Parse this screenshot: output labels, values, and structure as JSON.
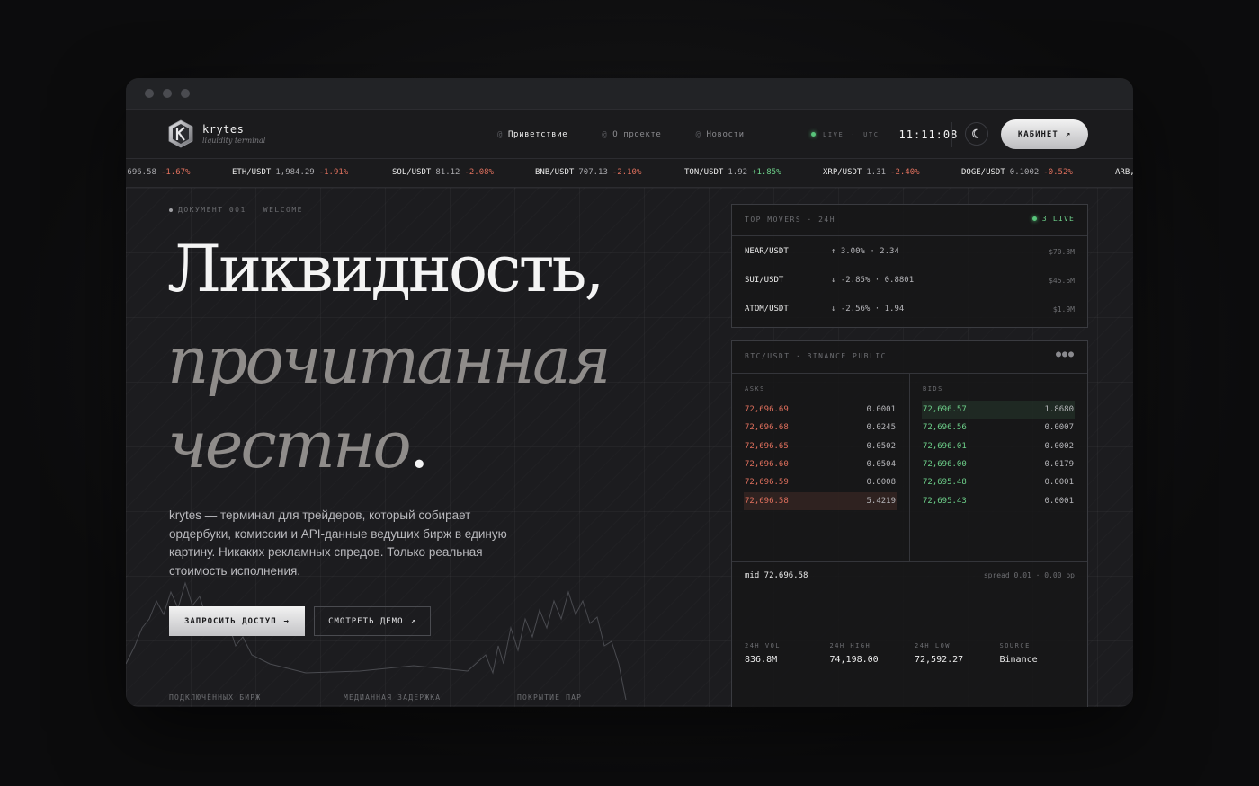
{
  "brand": {
    "name": "krytes",
    "tagline": "liquidity terminal"
  },
  "nav": {
    "tabs": [
      {
        "label": "Приветствие",
        "active": true
      },
      {
        "label": "О проекте",
        "active": false
      },
      {
        "label": "Новости",
        "active": false
      }
    ],
    "live_label": "LIVE",
    "tz_label": "UTC",
    "time": "11:11:08",
    "cabinet_label": "КАБИНЕТ",
    "cabinet_icon": "arrow-up-right-icon",
    "theme_icon": "moon-icon"
  },
  "ticker": [
    {
      "symbol": "",
      "price": ",696.58",
      "change": "-1.67%",
      "dir": "neg"
    },
    {
      "symbol": "ETH/USDT",
      "price": "1,984.29",
      "change": "-1.91%",
      "dir": "neg"
    },
    {
      "symbol": "SOL/USDT",
      "price": "81.12",
      "change": "-2.08%",
      "dir": "neg"
    },
    {
      "symbol": "BNB/USDT",
      "price": "707.13",
      "change": "-2.10%",
      "dir": "neg"
    },
    {
      "symbol": "TON/USDT",
      "price": "1.92",
      "change": "+1.85%",
      "dir": "pos"
    },
    {
      "symbol": "XRP/USDT",
      "price": "1.31",
      "change": "-2.40%",
      "dir": "neg"
    },
    {
      "symbol": "DOGE/USDT",
      "price": "0.1002",
      "change": "-0.52%",
      "dir": "neg"
    },
    {
      "symbol": "ARB,",
      "price": "",
      "change": "",
      "dir": "neg"
    }
  ],
  "hero": {
    "doc_label": "ДОКУМЕНТ 001 · WELCOME",
    "line1": "Ликвидность,",
    "line2": "прочитанная",
    "line3": "честно",
    "line3_end": ".",
    "description": "krytes — терминал для трейдеров, который собирает ордербуки, комиссии и API-данные ведущих бирж в единую картину. Никаких рекламных спредов. Только реальная стоимость исполнения.",
    "primary_cta": "ЗАПРОСИТЬ ДОСТУП",
    "primary_icon": "arrow-right-icon",
    "secondary_cta": "СМОТРЕТЬ ДЕМО",
    "secondary_icon": "arrow-up-right-icon",
    "stats": [
      "ПОДКЛЮЧЁННЫХ БИРЖ",
      "МЕДИАННАЯ ЗАДЕРЖКА",
      "ПОКРЫТИЕ ПАР"
    ]
  },
  "movers": {
    "title": "TOP MOVERS · 24H",
    "live": "3 LIVE",
    "rows": [
      {
        "symbol": "NEAR/USDT",
        "change": "↑ 3.00% · 2.34",
        "volume": "$70.3M"
      },
      {
        "symbol": "SUI/USDT",
        "change": "↓ -2.85% · 0.8801",
        "volume": "$45.6M"
      },
      {
        "symbol": "ATOM/USDT",
        "change": "↓ -2.56% · 1.94",
        "volume": "$1.9M"
      }
    ]
  },
  "book": {
    "title": "BTC/USDT · BINANCE PUBLIC",
    "more_icon": "more-dots-icon",
    "asks_label": "ASKS",
    "bids_label": "BIDS",
    "asks": [
      {
        "price": "72,696.69",
        "qty": "0.0001"
      },
      {
        "price": "72,696.68",
        "qty": "0.0245"
      },
      {
        "price": "72,696.65",
        "qty": "0.0502"
      },
      {
        "price": "72,696.60",
        "qty": "0.0504"
      },
      {
        "price": "72,696.59",
        "qty": "0.0008"
      },
      {
        "price": "72,696.58",
        "qty": "5.4219"
      }
    ],
    "bids": [
      {
        "price": "72,696.57",
        "qty": "1.8680"
      },
      {
        "price": "72,696.56",
        "qty": "0.0007"
      },
      {
        "price": "72,696.01",
        "qty": "0.0002"
      },
      {
        "price": "72,696.00",
        "qty": "0.0179"
      },
      {
        "price": "72,695.48",
        "qty": "0.0001"
      },
      {
        "price": "72,695.43",
        "qty": "0.0001"
      }
    ],
    "mid": "mid 72,696.58",
    "spread": "spread 0.01 · 0.00 bp",
    "footer": [
      {
        "label": "24H VOL",
        "value": "836.8M"
      },
      {
        "label": "24H HIGH",
        "value": "74,198.00"
      },
      {
        "label": "24H LOW",
        "value": "72,592.27"
      },
      {
        "label": "SOURCE",
        "value": "Binance"
      }
    ]
  },
  "colors": {
    "negative": "#e0705d",
    "positive": "#6dd08a",
    "accent": "#58c47a"
  }
}
